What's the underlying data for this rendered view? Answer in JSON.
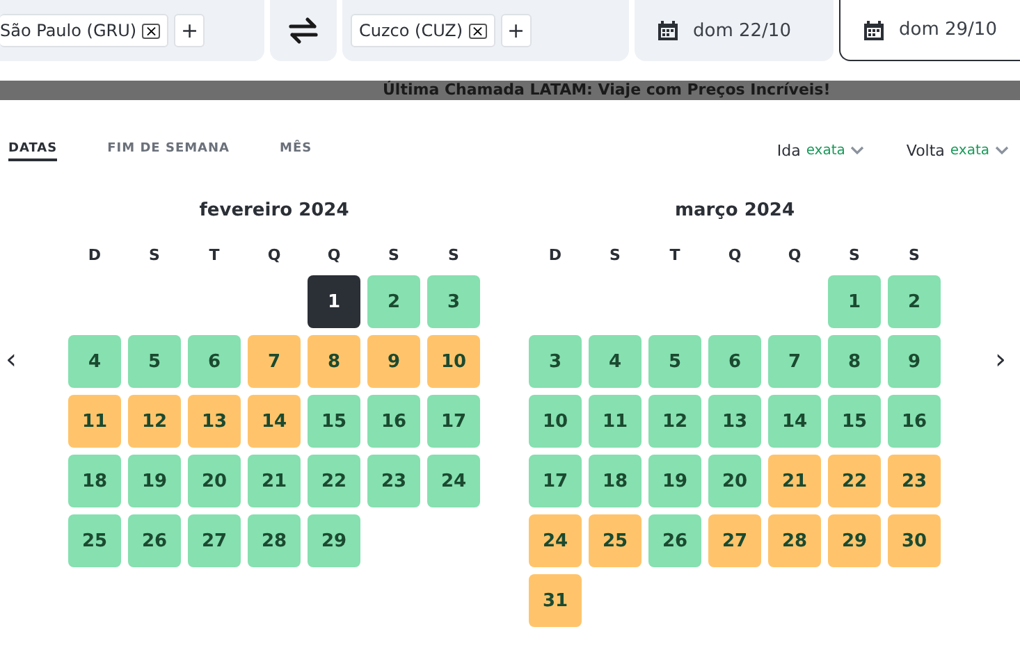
{
  "search_bar": {
    "origin": {
      "label": "São Paulo (GRU)",
      "remove": "×",
      "add": "+"
    },
    "destination": {
      "label": "Cuzco (CUZ)",
      "remove": "×",
      "add": "+"
    },
    "depart_date": {
      "label": "dom 22/10",
      "selected": false
    },
    "return_date": {
      "label": "dom 29/10",
      "selected": true
    }
  },
  "banner": {
    "text": "Última Chamada LATAM: Viaje com Preços Incríveis!"
  },
  "tabs": [
    {
      "label": "DATAS",
      "selected": true
    },
    {
      "label": "FIM DE SEMANA",
      "selected": false
    },
    {
      "label": "MÊS",
      "selected": false
    }
  ],
  "filters": [
    {
      "label": "Ida",
      "value": "exata"
    },
    {
      "label": "Volta",
      "value": "exata"
    }
  ],
  "nav": {
    "prev": "‹",
    "next": "›"
  },
  "months": [
    {
      "title": "fevereiro 2024",
      "weekdays": [
        "D",
        "S",
        "T",
        "Q",
        "Q",
        "S",
        "S"
      ],
      "weeks": [
        [
          {
            "kind": "empty"
          },
          {
            "kind": "empty"
          },
          {
            "kind": "empty"
          },
          {
            "kind": "empty"
          },
          {
            "kind": "day",
            "day": "1",
            "color": "#2b2f36",
            "selected": true
          },
          {
            "kind": "day",
            "day": "2",
            "color": "#86e0b0",
            "selected": false
          },
          {
            "kind": "day",
            "day": "3",
            "color": "#86e0b0",
            "selected": false
          }
        ],
        [
          {
            "kind": "day",
            "day": "4",
            "color": "#86e0b0",
            "selected": false
          },
          {
            "kind": "day",
            "day": "5",
            "color": "#86e0b0",
            "selected": false
          },
          {
            "kind": "day",
            "day": "6",
            "color": "#86e0b0",
            "selected": false
          },
          {
            "kind": "day",
            "day": "7",
            "color": "#ffc46b",
            "selected": false
          },
          {
            "kind": "day",
            "day": "8",
            "color": "#ffc46b",
            "selected": false
          },
          {
            "kind": "day",
            "day": "9",
            "color": "#ffc46b",
            "selected": false
          },
          {
            "kind": "day",
            "day": "10",
            "color": "#ffc46b",
            "selected": false
          }
        ],
        [
          {
            "kind": "day",
            "day": "11",
            "color": "#ffc46b",
            "selected": false
          },
          {
            "kind": "day",
            "day": "12",
            "color": "#ffc46b",
            "selected": false
          },
          {
            "kind": "day",
            "day": "13",
            "color": "#ffc46b",
            "selected": false
          },
          {
            "kind": "day",
            "day": "14",
            "color": "#ffc46b",
            "selected": false
          },
          {
            "kind": "day",
            "day": "15",
            "color": "#86e0b0",
            "selected": false
          },
          {
            "kind": "day",
            "day": "16",
            "color": "#86e0b0",
            "selected": false
          },
          {
            "kind": "day",
            "day": "17",
            "color": "#86e0b0",
            "selected": false
          }
        ],
        [
          {
            "kind": "day",
            "day": "18",
            "color": "#86e0b0",
            "selected": false
          },
          {
            "kind": "day",
            "day": "19",
            "color": "#86e0b0",
            "selected": false
          },
          {
            "kind": "day",
            "day": "20",
            "color": "#86e0b0",
            "selected": false
          },
          {
            "kind": "day",
            "day": "21",
            "color": "#86e0b0",
            "selected": false
          },
          {
            "kind": "day",
            "day": "22",
            "color": "#86e0b0",
            "selected": false
          },
          {
            "kind": "day",
            "day": "23",
            "color": "#86e0b0",
            "selected": false
          },
          {
            "kind": "day",
            "day": "24",
            "color": "#86e0b0",
            "selected": false
          }
        ],
        [
          {
            "kind": "day",
            "day": "25",
            "color": "#86e0b0",
            "selected": false
          },
          {
            "kind": "day",
            "day": "26",
            "color": "#86e0b0",
            "selected": false
          },
          {
            "kind": "day",
            "day": "27",
            "color": "#86e0b0",
            "selected": false
          },
          {
            "kind": "day",
            "day": "28",
            "color": "#86e0b0",
            "selected": false
          },
          {
            "kind": "day",
            "day": "29",
            "color": "#86e0b0",
            "selected": false
          }
        ]
      ]
    },
    {
      "title": "março 2024",
      "weekdays": [
        "D",
        "S",
        "T",
        "Q",
        "Q",
        "S",
        "S"
      ],
      "weeks": [
        [
          {
            "kind": "empty"
          },
          {
            "kind": "empty"
          },
          {
            "kind": "empty"
          },
          {
            "kind": "empty"
          },
          {
            "kind": "empty"
          },
          {
            "kind": "day",
            "day": "1",
            "color": "#86e0b0",
            "selected": false
          },
          {
            "kind": "day",
            "day": "2",
            "color": "#86e0b0",
            "selected": false
          }
        ],
        [
          {
            "kind": "day",
            "day": "3",
            "color": "#86e0b0",
            "selected": false
          },
          {
            "kind": "day",
            "day": "4",
            "color": "#86e0b0",
            "selected": false
          },
          {
            "kind": "day",
            "day": "5",
            "color": "#86e0b0",
            "selected": false
          },
          {
            "kind": "day",
            "day": "6",
            "color": "#86e0b0",
            "selected": false
          },
          {
            "kind": "day",
            "day": "7",
            "color": "#86e0b0",
            "selected": false
          },
          {
            "kind": "day",
            "day": "8",
            "color": "#86e0b0",
            "selected": false
          },
          {
            "kind": "day",
            "day": "9",
            "color": "#86e0b0",
            "selected": false
          }
        ],
        [
          {
            "kind": "day",
            "day": "10",
            "color": "#86e0b0",
            "selected": false
          },
          {
            "kind": "day",
            "day": "11",
            "color": "#86e0b0",
            "selected": false
          },
          {
            "kind": "day",
            "day": "12",
            "color": "#86e0b0",
            "selected": false
          },
          {
            "kind": "day",
            "day": "13",
            "color": "#86e0b0",
            "selected": false
          },
          {
            "kind": "day",
            "day": "14",
            "color": "#86e0b0",
            "selected": false
          },
          {
            "kind": "day",
            "day": "15",
            "color": "#86e0b0",
            "selected": false
          },
          {
            "kind": "day",
            "day": "16",
            "color": "#86e0b0",
            "selected": false
          }
        ],
        [
          {
            "kind": "day",
            "day": "17",
            "color": "#86e0b0",
            "selected": false
          },
          {
            "kind": "day",
            "day": "18",
            "color": "#86e0b0",
            "selected": false
          },
          {
            "kind": "day",
            "day": "19",
            "color": "#86e0b0",
            "selected": false
          },
          {
            "kind": "day",
            "day": "20",
            "color": "#86e0b0",
            "selected": false
          },
          {
            "kind": "day",
            "day": "21",
            "color": "#ffc46b",
            "selected": false
          },
          {
            "kind": "day",
            "day": "22",
            "color": "#ffc46b",
            "selected": false
          },
          {
            "kind": "day",
            "day": "23",
            "color": "#ffc46b",
            "selected": false
          }
        ],
        [
          {
            "kind": "day",
            "day": "24",
            "color": "#ffc46b",
            "selected": false
          },
          {
            "kind": "day",
            "day": "25",
            "color": "#ffc46b",
            "selected": false
          },
          {
            "kind": "day",
            "day": "26",
            "color": "#86e0b0",
            "selected": false
          },
          {
            "kind": "day",
            "day": "27",
            "color": "#ffc46b",
            "selected": false
          },
          {
            "kind": "day",
            "day": "28",
            "color": "#ffc46b",
            "selected": false
          },
          {
            "kind": "day",
            "day": "29",
            "color": "#ffc46b",
            "selected": false
          },
          {
            "kind": "day",
            "day": "30",
            "color": "#ffc46b",
            "selected": false
          }
        ],
        [
          {
            "kind": "day",
            "day": "31",
            "color": "#ffc46b",
            "selected": false
          }
        ]
      ]
    }
  ]
}
